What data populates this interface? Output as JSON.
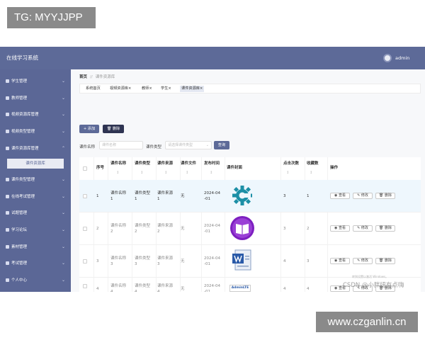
{
  "watermark_top": "TG: MYYJJPP",
  "watermark_bottom": "www.czganlin.cn",
  "app": {
    "title": "在线学习系统",
    "user": "admin"
  },
  "sidebar": {
    "items": [
      {
        "label": "学生管理",
        "icon": "user-icon"
      },
      {
        "label": "教师管理",
        "icon": "teacher-icon"
      },
      {
        "label": "视频资源库管理",
        "icon": "video-icon"
      },
      {
        "label": "视频类型管理",
        "icon": "list-icon"
      },
      {
        "label": "课件资源库管理",
        "icon": "grid-icon"
      },
      {
        "label": "课件类型管理",
        "icon": "grid-icon"
      },
      {
        "label": "在线考试管理",
        "icon": "grid-icon"
      },
      {
        "label": "试题管理",
        "icon": "grid-icon"
      },
      {
        "label": "学习论坛",
        "icon": "grid-icon"
      },
      {
        "label": "素材管理",
        "icon": "pin-icon"
      },
      {
        "label": "考试管理",
        "icon": "pencil-icon"
      },
      {
        "label": "个人中心",
        "icon": "profile-icon"
      }
    ],
    "sub_item": "课件资源库"
  },
  "breadcrumb": {
    "home": "首页",
    "sep": "//",
    "current": "课件资源库"
  },
  "tags": [
    "系统首页",
    "视频资源库×",
    "教师×",
    "学生×",
    "课件资源库×"
  ],
  "toolbar": {
    "add_label": "+ 添加",
    "delete_label": "删除"
  },
  "filter": {
    "name_label": "课件名称",
    "name_placeholder": "课件名称",
    "type_label": "课件类型",
    "type_placeholder": "请选择课件类型",
    "search_label": "查询"
  },
  "table": {
    "columns": [
      "序号",
      "课件名称",
      "课件类型",
      "课件来源",
      "课件文件",
      "发布时间",
      "课件封面",
      "点击次数",
      "收藏数",
      "操作"
    ],
    "sort_glyph": "↕",
    "rows": [
      {
        "no": "1",
        "name": "课件名称\n1",
        "type": "课件类型\n1",
        "source": "课件来源\n1",
        "file": "无",
        "time": "2024-04\n-01",
        "clicks": "3",
        "favs": "1",
        "cover": "gear"
      },
      {
        "no": "2",
        "name": "课件名称\n2",
        "type": "课件类型\n2",
        "source": "课件来源\n2",
        "file": "无",
        "time": "2024-04\n-01",
        "clicks": "3",
        "favs": "2",
        "cover": "book"
      },
      {
        "no": "3",
        "name": "课件名称\n3",
        "type": "课件类型\n3",
        "source": "课件来源\n3",
        "file": "无",
        "time": "2024-04\n-01",
        "clicks": "4",
        "favs": "3",
        "cover": "doc"
      },
      {
        "no": "4",
        "name": "课件名称\n4",
        "type": "课件类型\n4",
        "source": "课件来源\n4",
        "file": "无",
        "time": "2024-04\n-01",
        "clicks": "4",
        "favs": "4",
        "cover": "adminlte"
      }
    ],
    "view_label": "查看",
    "edit_label": "修改",
    "del_label": "删除",
    "adminlte_text": "AdminLTE"
  },
  "csdn_watermark": "CSDN @小胖妞有点嗨",
  "csdn_overlay": "转到设置以激活 Windows。",
  "colors": {
    "topbar": "#5d6a98",
    "sidebar": "#5b6796",
    "btn_add": "#5d6a98",
    "btn_delete": "#2f3452",
    "search": "#5d6a98"
  }
}
